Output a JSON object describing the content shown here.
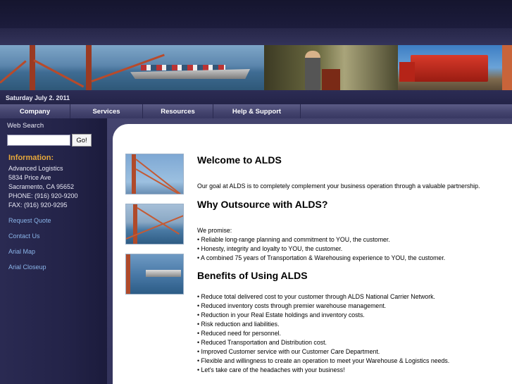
{
  "date": "Saturday July 2. 2011",
  "nav": {
    "company": "Company",
    "services": "Services",
    "resources": "Resources",
    "help": "Help & Support"
  },
  "sidebar": {
    "search_label": "Web Search",
    "search_value": "",
    "go_label": "Go!",
    "info_heading": "Information:",
    "info_lines": [
      "Advanced Logistics",
      "5834 Price Ave",
      "Sacramento, CA 95652",
      "PHONE: (916) 920-9200",
      "FAX: (916) 920-9295"
    ],
    "links": [
      "Request Quote",
      "Contact Us",
      "Arial Map",
      "Arial Closeup"
    ]
  },
  "content": {
    "welcome_title": "Welcome to ALDS",
    "welcome_text": "Our goal at ALDS is to completely complement your business operation through a valuable partnership.",
    "outsource_title": "Why Outsource with ALDS?",
    "outsource_intro": "We promise:",
    "outsource_items": [
      "• Reliable long-range planning and commitment to YOU, the customer.",
      "• Honesty, integrity and loyalty to YOU, the customer.",
      "• A combined 75 years of Transportation & Warehousing experience to YOU, the customer."
    ],
    "benefits_title": "Benefits of Using ALDS",
    "benefits_items": [
      "• Reduce total delivered cost to your customer through ALDS National Carrier Network.",
      "• Reduced inventory costs through premier warehouse management.",
      "• Reduction in your Real Estate holdings and inventory costs.",
      "• Risk reduction and liabilities.",
      "• Reduced need for personnel.",
      "• Reduced Transportation and Distribution cost.",
      "• Improved Customer service with our Customer Care Department.",
      "• Flexible and willingness to create an operation to meet your Warehouse & Logistics needs.",
      "• Let's take care of the headaches with your business!"
    ]
  },
  "colors": {
    "info_heading": "#e8a83a",
    "side_link": "#8ab4e8",
    "nav_bg": "#44446e"
  }
}
